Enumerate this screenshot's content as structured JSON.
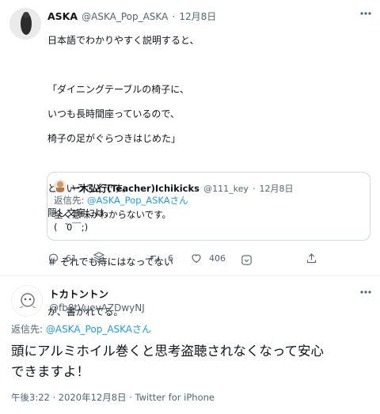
{
  "tweet": {
    "name": "ASKA",
    "handle": "@ASKA_Pop_ASKA",
    "separator": "·",
    "date": "12月8日",
    "more_icon": "more-dots-icon",
    "lines": [
      "日本語でわかりやすく説明すると、",
      "",
      "「ダイニングテーブルの椅子に、",
      "いつも長時間座っているので、",
      "椅子の足がぐらつきはじめた」",
      "",
      "と、いうことです。",
      "隠し文字には、",
      "",
      "＃ それでも痔にはなってない",
      "",
      "が、書かれてる。"
    ],
    "quote": {
      "name": "一木弘行(Teacher)Ichikicks",
      "handle": "@111_key",
      "separator": "·",
      "date": "12月8日",
      "reply_prefix": "返信先: ",
      "reply_to": "@ASKA_Pop_ASKAさん",
      "line1": "全く意味がわからないです。",
      "line2": "(　̄0￣;)"
    },
    "actions": {
      "reply_count": "61",
      "retweet_count": "6",
      "like_count": "406"
    }
  },
  "reply": {
    "name": "トカトントン",
    "handle": "@fb8tVuevAZDwyNJ",
    "reply_prefix": "返信先: ",
    "reply_to": "@ASKA_Pop_ASKAさん",
    "text_line1": "頭にアルミホイル巻くと思考盗聴されなくなって安心",
    "text_line2": "できますよ！",
    "time": "午後3:22",
    "date": "2020年12月8日",
    "source": "Twitter for iPhone",
    "separator": "·"
  },
  "colors": {
    "accent": "#1d9bf0",
    "secondary_text": "#536471",
    "border": "#cfd9de"
  }
}
